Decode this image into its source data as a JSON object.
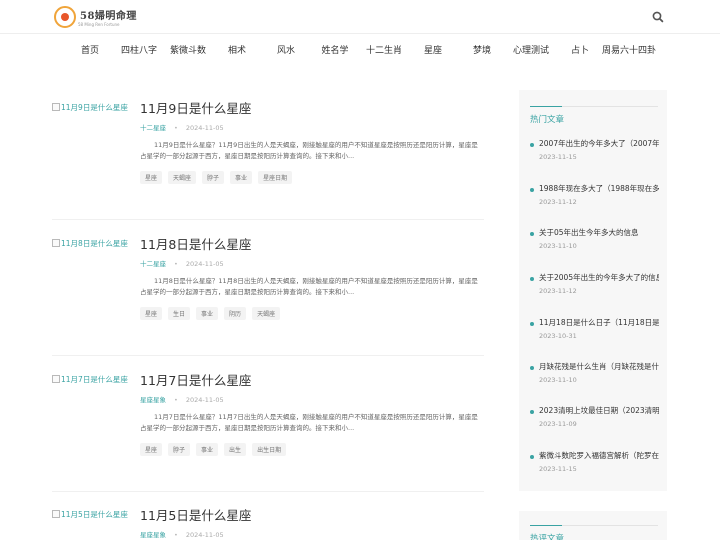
{
  "header": {
    "logo_text": "58婦明命理",
    "logo_sub": "58 Ming Ren Fortune"
  },
  "nav": {
    "items": [
      "首页",
      "四柱八字",
      "紫微斗数",
      "相术",
      "风水",
      "姓名学",
      "十二生肖",
      "星座",
      "梦境",
      "心理测试",
      "占卜",
      "周易六十四卦"
    ]
  },
  "posts": [
    {
      "thumb_alt": "11月9日是什么星座",
      "title": "11月9日是什么星座",
      "category": "十二星座",
      "date": "2024-11-05",
      "excerpt": "11月9日是什么星座？11月9日出生的人是天蝎座，刚接触星座的用户不知道星座是按照历还是阳历计算，星座是占星学的一部分起源于西方，星座日期是按阳历计算查询的。接下来和小...",
      "tags": [
        "星座",
        "天蝎座",
        "脖子",
        "事业",
        "星座日期"
      ]
    },
    {
      "thumb_alt": "11月8日是什么星座",
      "title": "11月8日是什么星座",
      "category": "十二星座",
      "date": "2024-11-05",
      "excerpt": "11月8日是什么星座？11月8日出生的人是天蝎座，刚接触星座的用户不知道星座是按照历还是阳历计算，星座是占星学的一部分起源于西方，星座日期是按阳历计算查询的。接下来和小...",
      "tags": [
        "星座",
        "生日",
        "事业",
        "阴历",
        "天蝎座"
      ]
    },
    {
      "thumb_alt": "11月7日是什么星座",
      "title": "11月7日是什么星座",
      "category": "星座星象",
      "date": "2024-11-05",
      "excerpt": "11月7日是什么星座？11月7日出生的人是天蝎座，刚接触星座的用户不知道星座是按照历还是阳历计算，星座是占星学的一部分起源于西方，星座日期是按阳历计算查询的。接下来和小...",
      "tags": [
        "星座",
        "脖子",
        "事业",
        "出生",
        "出生日期"
      ]
    },
    {
      "thumb_alt": "11月5日是什么星座",
      "title": "11月5日是什么星座",
      "category": "星座星象",
      "date": "2024-11-05",
      "excerpt": "",
      "tags": []
    }
  ],
  "sidebar": {
    "title": "热门文章",
    "items": [
      {
        "title": "2007年出生的今年多大了（2007年出",
        "date": "2023-11-15"
      },
      {
        "title": "1988年现在多大了（1988年现在多大",
        "date": "2023-11-12"
      },
      {
        "title": "关于05年出生今年多大的信息",
        "date": "2023-11-10"
      },
      {
        "title": "关于2005年出生的今年多大了的信息",
        "date": "2023-11-12"
      },
      {
        "title": "11月18日是什么日子（11月18日是什",
        "date": "2023-10-31"
      },
      {
        "title": "月缺花残是什么生肖（月缺花残是什",
        "date": "2023-11-10"
      },
      {
        "title": "2023清明上坟最佳日期（2023清明上",
        "date": "2023-11-09"
      },
      {
        "title": "紫微斗数陀罗入福德宫解析（陀罗在",
        "date": "2023-11-15"
      }
    ],
    "second_title": "热评文章"
  },
  "colors": {
    "accent": "#3aa3a3",
    "text": "#333333",
    "muted": "#999999",
    "sidebar_bg": "#f7f7f7"
  },
  "icons": {
    "search": "search-icon"
  }
}
